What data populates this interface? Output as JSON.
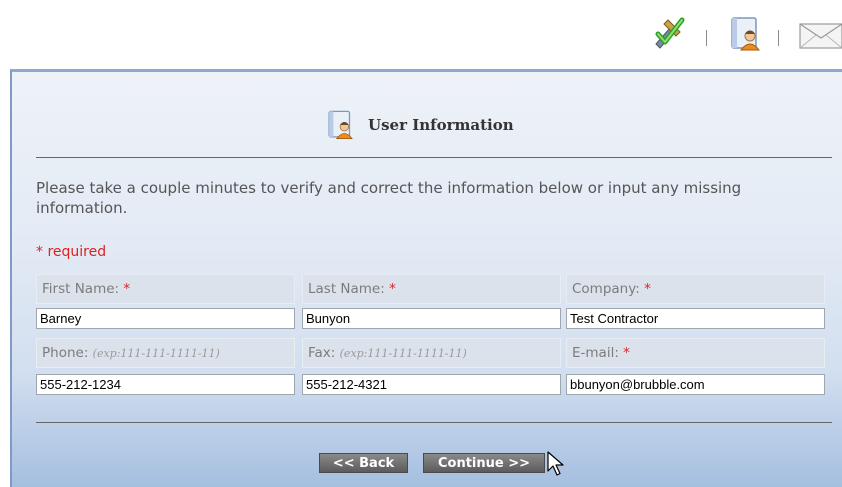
{
  "toolbar": {
    "icons": [
      "tools-check-icon",
      "user-info-icon",
      "mail-icon"
    ]
  },
  "panel": {
    "title": "User Information",
    "intro": "Please take a couple minutes to verify and correct the information below or input any missing information.",
    "required_note": "* required"
  },
  "fields": {
    "first_name": {
      "label": "First Name:",
      "required": "*",
      "value": "Barney"
    },
    "last_name": {
      "label": "Last Name:",
      "required": "*",
      "value": "Bunyon"
    },
    "company": {
      "label": "Company:",
      "required": "*",
      "value": "Test Contractor"
    },
    "phone": {
      "label": "Phone:",
      "hint": "(exp:111-111-1111-11)",
      "value": "555-212-1234"
    },
    "fax": {
      "label": "Fax:",
      "hint": "(exp:111-111-1111-11)",
      "value": "555-212-4321"
    },
    "email": {
      "label": "E-mail:",
      "required": "*",
      "value": "bbunyon@brubble.com"
    }
  },
  "buttons": {
    "back": "<< Back",
    "continue": "Continue >>"
  },
  "colors": {
    "required": "#e02020",
    "panel_border": "#8ea9cf",
    "button_bg": "#6b6b6b"
  }
}
